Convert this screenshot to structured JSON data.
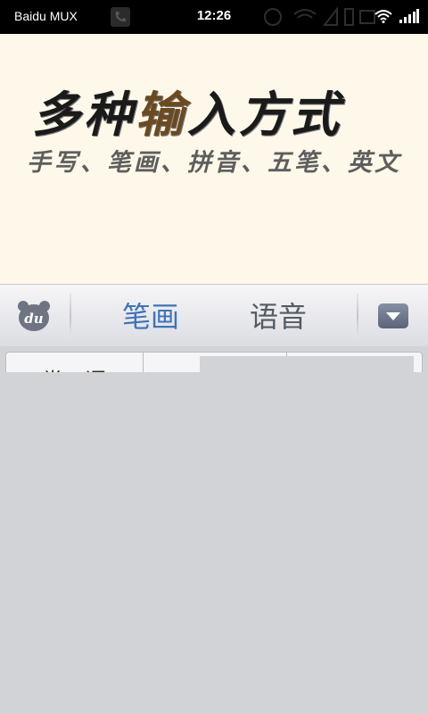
{
  "status_bar": {
    "carrier": "Baidu MUX",
    "time": "12:26"
  },
  "banner": {
    "title_part1": "多种",
    "title_highlight": "输",
    "title_part2": "入方式",
    "subtitle": "手写、笔画、拼音、五笔、英文"
  },
  "toolbar": {
    "logo_text": "du",
    "tab_active": "笔画",
    "tab_inactive": "语音"
  },
  "keyboard": {
    "partial_candidate": "常口语"
  }
}
